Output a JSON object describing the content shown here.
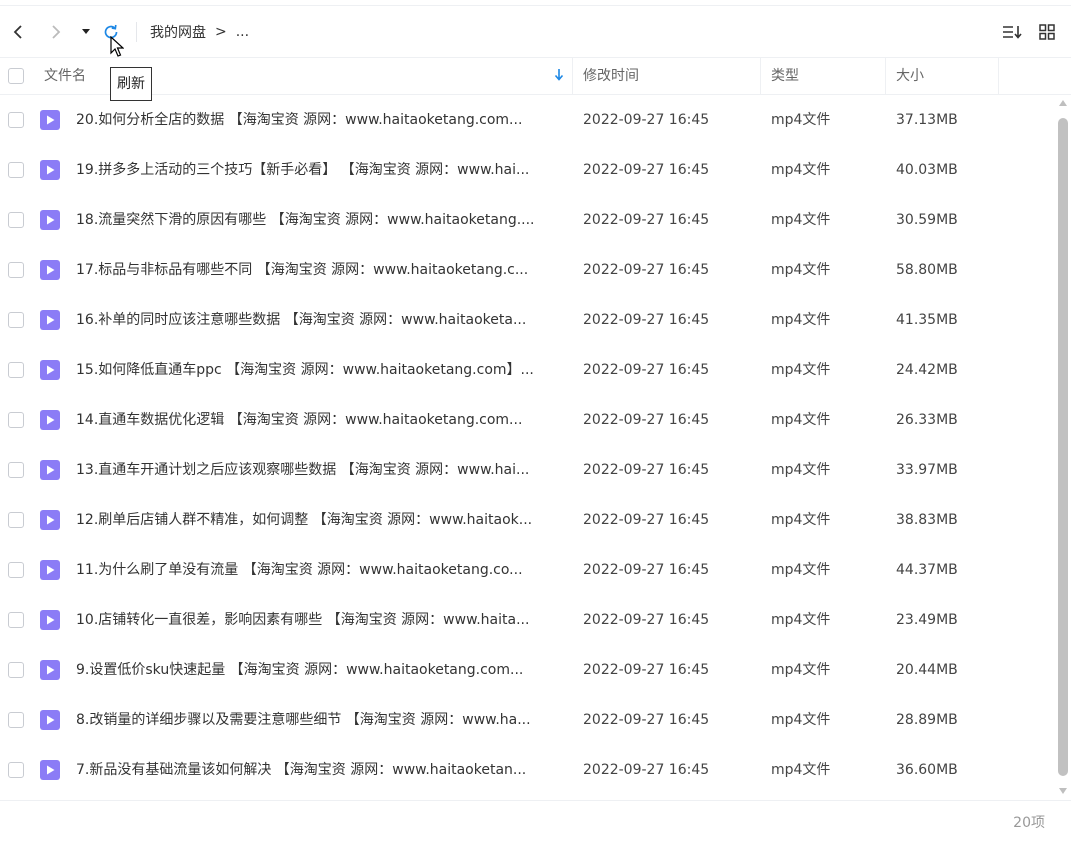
{
  "toolbar": {
    "back_icon": "chevron-left-icon",
    "forward_icon": "chevron-right-icon",
    "history_icon": "caret-down-icon",
    "refresh_icon": "refresh-icon",
    "breadcrumb_root": "我的网盘",
    "breadcrumb_sep": ">",
    "breadcrumb_more": "...",
    "sort_icon": "sort-list-icon",
    "view_icon": "grid-view-icon"
  },
  "tooltip": {
    "text": "刷新"
  },
  "columns": {
    "name": "文件名",
    "modified": "修改时间",
    "type": "类型",
    "size": "大小"
  },
  "colors": {
    "file_icon": "#8b7cf6",
    "accent": "#1e88e5",
    "refresh": "#1e88e5"
  },
  "files": [
    {
      "name": "20.如何分析全店的数据 【海淘宝资 源网：www.haitaoketang.com...",
      "modified": "2022-09-27 16:45",
      "type": "mp4文件",
      "size": "37.13MB"
    },
    {
      "name": "19.拼多多上活动的三个技巧【新手必看】 【海淘宝资 源网：www.hai...",
      "modified": "2022-09-27 16:45",
      "type": "mp4文件",
      "size": "40.03MB"
    },
    {
      "name": "18.流量突然下滑的原因有哪些 【海淘宝资 源网：www.haitaoketang....",
      "modified": "2022-09-27 16:45",
      "type": "mp4文件",
      "size": "30.59MB"
    },
    {
      "name": "17.标品与非标品有哪些不同 【海淘宝资 源网：www.haitaoketang.c...",
      "modified": "2022-09-27 16:45",
      "type": "mp4文件",
      "size": "58.80MB"
    },
    {
      "name": "16.补单的同时应该注意哪些数据 【海淘宝资 源网：www.haitaoketa...",
      "modified": "2022-09-27 16:45",
      "type": "mp4文件",
      "size": "41.35MB"
    },
    {
      "name": "15.如何降低直通车ppc 【海淘宝资 源网：www.haitaoketang.com】...",
      "modified": "2022-09-27 16:45",
      "type": "mp4文件",
      "size": "24.42MB"
    },
    {
      "name": "14.直通车数据优化逻辑 【海淘宝资 源网：www.haitaoketang.com...",
      "modified": "2022-09-27 16:45",
      "type": "mp4文件",
      "size": "26.33MB"
    },
    {
      "name": "13.直通车开通计划之后应该观察哪些数据 【海淘宝资 源网：www.hai...",
      "modified": "2022-09-27 16:45",
      "type": "mp4文件",
      "size": "33.97MB"
    },
    {
      "name": "12.刷单后店铺人群不精准，如何调整 【海淘宝资 源网：www.haitaok...",
      "modified": "2022-09-27 16:45",
      "type": "mp4文件",
      "size": "38.83MB"
    },
    {
      "name": "11.为什么刷了单没有流量 【海淘宝资 源网：www.haitaoketang.co...",
      "modified": "2022-09-27 16:45",
      "type": "mp4文件",
      "size": "44.37MB"
    },
    {
      "name": "10.店铺转化一直很差，影响因素有哪些 【海淘宝资 源网：www.haita...",
      "modified": "2022-09-27 16:45",
      "type": "mp4文件",
      "size": "23.49MB"
    },
    {
      "name": "9.设置低价sku快速起量 【海淘宝资 源网：www.haitaoketang.com...",
      "modified": "2022-09-27 16:45",
      "type": "mp4文件",
      "size": "20.44MB"
    },
    {
      "name": "8.改销量的详细步骤以及需要注意哪些细节 【海淘宝资 源网：www.ha...",
      "modified": "2022-09-27 16:45",
      "type": "mp4文件",
      "size": "28.89MB"
    },
    {
      "name": "7.新品没有基础流量该如何解决 【海淘宝资 源网：www.haitaoketan...",
      "modified": "2022-09-27 16:45",
      "type": "mp4文件",
      "size": "36.60MB"
    }
  ],
  "footer": {
    "count": "20项"
  }
}
